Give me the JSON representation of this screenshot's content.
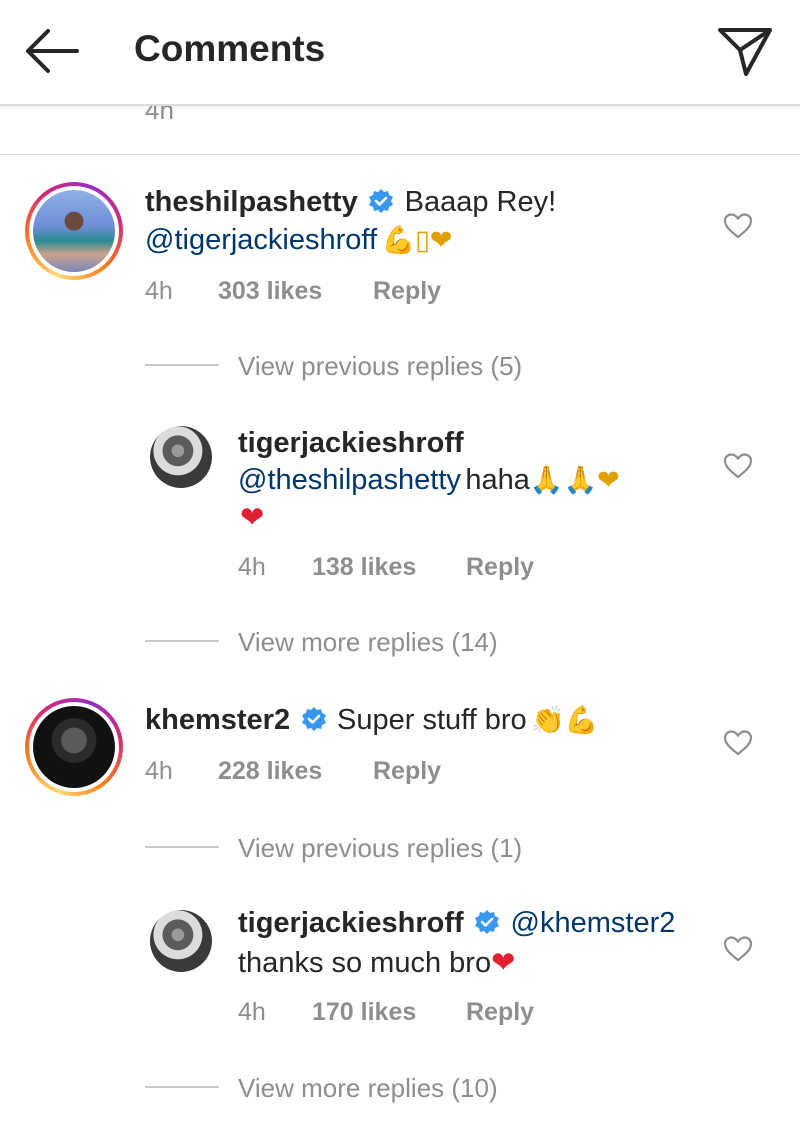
{
  "header": {
    "title": "Comments",
    "back_icon": "back-arrow-icon",
    "send_icon": "send-icon"
  },
  "partial_time": "4h",
  "comments": [
    {
      "username": "theshilpashetty",
      "verified": true,
      "text": "Baaap Rey!",
      "mention": "@tigerjackieshroff",
      "emoji": "💪▯❤",
      "time": "4h",
      "likes": "303 likes",
      "reply": "Reply",
      "view_replies": "View previous replies (5)",
      "replies": [
        {
          "username": "tigerjackieshroff",
          "mention": "@theshilpashetty",
          "text": "haha",
          "emoji_line1": "🙏🙏❤",
          "emoji_line2": "❤",
          "time": "4h",
          "likes": "138 likes",
          "reply": "Reply"
        }
      ],
      "view_more": "View more replies (14)"
    },
    {
      "username": "khemster2",
      "verified": true,
      "text": "Super stuff bro",
      "emoji": "👏💪",
      "time": "4h",
      "likes": "228 likes",
      "reply": "Reply",
      "view_replies": "View previous replies (1)",
      "replies": [
        {
          "username": "tigerjackieshroff",
          "verified": true,
          "mention": "@khemster2",
          "text": "thanks so much bro",
          "emoji": "❤",
          "time": "4h",
          "likes": "170 likes",
          "reply": "Reply"
        }
      ],
      "view_more": "View more replies (10)"
    }
  ],
  "colors": {
    "text": "#262626",
    "secondary": "#8e8e8e",
    "mention": "#00376b",
    "verified": "#3897f0",
    "heart": "#e0202e"
  }
}
